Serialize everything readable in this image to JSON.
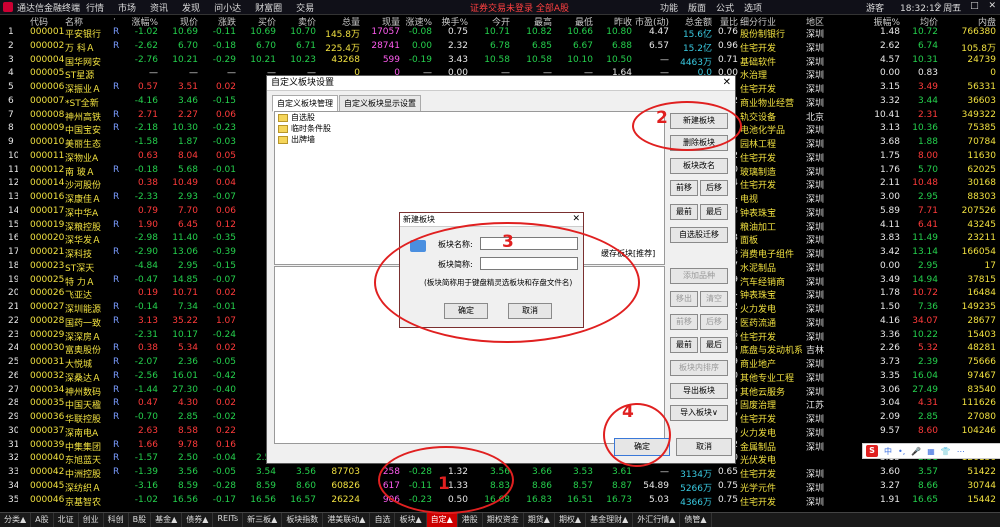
{
  "app": {
    "title": "通达信金融终端",
    "menu": [
      "行情",
      "市场",
      "资讯",
      "发现",
      "问小达",
      "财富圈",
      "交易"
    ],
    "notice": "证券交易未登录  全部A股",
    "right_menu": [
      "功能",
      "版面",
      "公式",
      "选项"
    ],
    "user": "游客",
    "clock": "18:32:12 周五",
    "window_buttons": [
      "◇",
      "—",
      "□",
      "✕"
    ]
  },
  "table": {
    "headers": [
      "代码",
      "名称",
      "·",
      "涨幅%",
      "现价",
      "涨跌",
      "买价",
      "卖价",
      "总量",
      "现量",
      "涨速%",
      "换手%",
      "今开",
      "最高",
      "最低",
      "昨收",
      "市盈(动)",
      "总金额",
      "量比",
      "细分行业",
      "地区",
      "振幅%",
      "均价",
      "内盘"
    ],
    "rows": [
      [
        "1",
        "000001",
        "平安银行",
        "R",
        "-1.02",
        "10.69",
        "-0.11",
        "10.69",
        "10.70",
        "145.8万",
        "17057",
        "-0.08",
        "0.75",
        "10.71",
        "10.82",
        "10.66",
        "10.80",
        "4.47",
        "15.6亿",
        "0.76",
        "股份制银行",
        "深圳",
        "1.48",
        "10.72",
        "766380"
      ],
      [
        "2",
        "000002",
        "万 科Ａ",
        "R",
        "-2.62",
        "6.70",
        "-0.18",
        "6.70",
        "6.71",
        "225.4万",
        "28741",
        "0.00",
        "2.32",
        "6.78",
        "6.85",
        "6.67",
        "6.88",
        "6.57",
        "15.2亿",
        "0.96",
        "住宅开发",
        "深圳",
        "2.62",
        "6.74",
        "105.8万"
      ],
      [
        "3",
        "000004",
        "国华网安",
        "",
        "-2.76",
        "10.21",
        "-0.29",
        "10.21",
        "10.23",
        "43268",
        "599",
        "-0.19",
        "3.43",
        "10.58",
        "10.58",
        "10.10",
        "10.50",
        "—",
        "4463万",
        "0.71",
        "基础软件",
        "深圳",
        "4.57",
        "10.31",
        "24739"
      ],
      [
        "4",
        "000005",
        "ST星源",
        "",
        "—",
        "—",
        "—",
        "—",
        "—",
        "0",
        "0",
        "—",
        "0.00",
        "—",
        "—",
        "—",
        "1.64",
        "—",
        "0.0",
        "0.00",
        "水治理",
        "深圳",
        "0.00",
        "0.83",
        "0"
      ],
      [
        "5",
        "000006",
        "深振业Ａ",
        "R",
        "0.57",
        "3.51",
        "0.02",
        "",
        "",
        "",
        "",
        "",
        "",
        "",
        "",
        "",
        "",
        "",
        "",
        "",
        "住宅开发",
        "深圳",
        "3.15",
        "3.49",
        "56331"
      ],
      [
        "6",
        "000007",
        "*ST全新",
        "",
        "-4.16",
        "3.46",
        "-0.15",
        "",
        "",
        "",
        "",
        "",
        "",
        "",
        "",
        "",
        "",
        "",
        "",
        "1.92",
        "商业物业经营",
        "深圳",
        "3.32",
        "3.44",
        "36603"
      ],
      [
        "7",
        "000008",
        "神州高铁",
        "R",
        "2.71",
        "2.27",
        "0.06",
        "",
        "",
        "",
        "",
        "",
        "",
        "",
        "",
        "",
        "",
        "",
        "",
        "",
        "轨交设备",
        "北京",
        "10.41",
        "2.31",
        "349322"
      ],
      [
        "8",
        "000009",
        "中国宝安",
        "R",
        "-2.18",
        "10.30",
        "-0.23",
        "",
        "",
        "",
        "",
        "",
        "",
        "",
        "",
        "",
        "",
        "",
        "",
        "",
        "电池化学品",
        "深圳",
        "3.13",
        "10.36",
        "75385"
      ],
      [
        "9",
        "000010",
        "美丽生态",
        "",
        "-1.58",
        "1.87",
        "-0.03",
        "",
        "",
        "",
        "",
        "",
        "",
        "",
        "",
        "",
        "",
        "",
        "",
        "",
        "园林工程",
        "深圳",
        "3.68",
        "1.88",
        "70784"
      ],
      [
        "10",
        "000011",
        "深物业A",
        "",
        "0.63",
        "8.04",
        "0.05",
        "",
        "",
        "",
        "",
        "",
        "",
        "",
        "",
        "",
        "",
        "",
        "",
        "0.72",
        "住宅开发",
        "深圳",
        "1.75",
        "8.00",
        "11630"
      ],
      [
        "11",
        "000012",
        "南 玻Ａ",
        "R",
        "-0.18",
        "5.68",
        "-0.01",
        "",
        "",
        "",
        "",
        "",
        "",
        "",
        "",
        "",
        "",
        "",
        "",
        "0.80",
        "玻璃制造",
        "深圳",
        "1.76",
        "5.70",
        "62025"
      ],
      [
        "12",
        "000014",
        "沙河股份",
        "",
        "0.38",
        "10.49",
        "0.04",
        "",
        "",
        "",
        "",
        "",
        "",
        "",
        "",
        "",
        "",
        "",
        "",
        "0.84",
        "住宅开发",
        "深圳",
        "2.11",
        "10.48",
        "30168"
      ],
      [
        "13",
        "000016",
        "深康佳Ａ",
        "R",
        "-2.33",
        "2.93",
        "-0.07",
        "",
        "",
        "",
        "",
        "",
        "",
        "",
        "",
        "",
        "",
        "",
        "",
        "0.81",
        "电视",
        "深圳",
        "3.00",
        "2.95",
        "88303"
      ],
      [
        "14",
        "000017",
        "深中华A",
        "",
        "0.79",
        "7.70",
        "0.06",
        "",
        "",
        "",
        "",
        "",
        "",
        "",
        "",
        "",
        "",
        "",
        "",
        "0.88",
        "钟表珠宝",
        "深圳",
        "5.89",
        "7.71",
        "207526"
      ],
      [
        "15",
        "000019",
        "深粮控股",
        "R",
        "1.90",
        "6.45",
        "0.12",
        "",
        "",
        "",
        "",
        "",
        "",
        "",
        "",
        "",
        "",
        "",
        "",
        "",
        "粮油加工",
        "深圳",
        "4.11",
        "6.41",
        "43245"
      ],
      [
        "16",
        "000020",
        "深华发Ａ",
        "",
        "-2.98",
        "11.40",
        "-0.35",
        "",
        "",
        "",
        "",
        "",
        "",
        "",
        "",
        "",
        "",
        "",
        "",
        "0.63",
        "面板",
        "深圳",
        "3.83",
        "11.49",
        "23211"
      ],
      [
        "17",
        "000021",
        "深科技",
        "R",
        "-2.90",
        "13.06",
        "-0.39",
        "",
        "",
        "",
        "",
        "",
        "",
        "",
        "",
        "",
        "",
        "",
        "",
        "0.76",
        "消费电子组件",
        "深圳",
        "3.42",
        "13.14",
        "166054"
      ],
      [
        "18",
        "000023",
        "ST深天",
        "",
        "-4.84",
        "2.95",
        "-0.15",
        "",
        "",
        "",
        "",
        "",
        "",
        "",
        "",
        "",
        "",
        "",
        "",
        "0.07",
        "水泥制品",
        "深圳",
        "0.00",
        "2.95",
        "17"
      ],
      [
        "19",
        "000025",
        "特 力Ａ",
        "R",
        "-0.47",
        "14.85",
        "-0.07",
        "",
        "",
        "",
        "",
        "",
        "",
        "",
        "",
        "",
        "",
        "",
        "",
        "0.39",
        "汽车经销商",
        "深圳",
        "3.49",
        "14.94",
        "37815"
      ],
      [
        "20",
        "000026",
        "飞亚达",
        "",
        "0.19",
        "10.71",
        "0.02",
        "",
        "",
        "",
        "",
        "",
        "",
        "",
        "",
        "",
        "",
        "",
        "",
        "0.51",
        "钟表珠宝",
        "深圳",
        "1.78",
        "10.72",
        "16484"
      ],
      [
        "21",
        "000027",
        "深圳能源",
        "R",
        "-0.14",
        "7.34",
        "-0.01",
        "",
        "",
        "",
        "",
        "",
        "",
        "",
        "",
        "",
        "",
        "",
        "",
        "0.72",
        "火力发电",
        "深圳",
        "1.50",
        "7.36",
        "149235"
      ],
      [
        "22",
        "000028",
        "国药一致",
        "R",
        "3.13",
        "35.22",
        "1.07",
        "",
        "",
        "",
        "",
        "",
        "",
        "",
        "",
        "",
        "",
        "",
        "",
        "0.92",
        "医药流通",
        "深圳",
        "4.16",
        "34.07",
        "28677"
      ],
      [
        "23",
        "000029",
        "深深房Ａ",
        "",
        "-2.31",
        "10.17",
        "-0.24",
        "",
        "",
        "",
        "",
        "",
        "",
        "",
        "",
        "",
        "",
        "",
        "",
        "0.86",
        "住宅开发",
        "深圳",
        "3.36",
        "10.22",
        "15403"
      ],
      [
        "24",
        "000030",
        "富奥股份",
        "R",
        "0.38",
        "5.34",
        "0.02",
        "",
        "",
        "",
        "",
        "",
        "",
        "",
        "",
        "",
        "",
        "",
        "",
        "0.75",
        "底盘与发动机系",
        "吉林",
        "2.26",
        "5.32",
        "48281"
      ],
      [
        "25",
        "000031",
        "大悦城",
        "R",
        "-2.07",
        "2.36",
        "-0.05",
        "",
        "",
        "",
        "",
        "",
        "",
        "",
        "",
        "",
        "",
        "",
        "",
        "0.89",
        "商业地产",
        "深圳",
        "3.73",
        "2.39",
        "75666"
      ],
      [
        "26",
        "000032",
        "深桑达Ａ",
        "R",
        "-2.56",
        "16.01",
        "-0.42",
        "",
        "",
        "",
        "",
        "",
        "",
        "",
        "",
        "",
        "",
        "",
        "",
        "1.00",
        "其他专业工程",
        "深圳",
        "3.35",
        "16.04",
        "97467"
      ],
      [
        "27",
        "000034",
        "神州数码",
        "R",
        "-1.44",
        "27.30",
        "-0.40",
        "",
        "",
        "",
        "",
        "",
        "",
        "",
        "",
        "",
        "",
        "",
        "",
        "0.65",
        "其他云服务",
        "深圳",
        "3.06",
        "27.49",
        "83540"
      ],
      [
        "28",
        "000035",
        "中国天楹",
        "R",
        "0.47",
        "4.30",
        "0.02",
        "",
        "",
        "",
        "",
        "",
        "",
        "",
        "",
        "",
        "",
        "",
        "",
        "0.73",
        "固废治理",
        "江苏",
        "3.04",
        "4.31",
        "111626"
      ],
      [
        "29",
        "000036",
        "华联控股",
        "R",
        "-0.70",
        "2.85",
        "-0.02",
        "",
        "",
        "",
        "",
        "",
        "",
        "",
        "",
        "",
        "",
        "",
        "",
        "0.97",
        "住宅开发",
        "深圳",
        "2.09",
        "2.85",
        "27080"
      ],
      [
        "30",
        "000037",
        "深南电A",
        "",
        "2.63",
        "8.58",
        "0.22",
        "",
        "",
        "",
        "",
        "",
        "",
        "",
        "",
        "",
        "",
        "",
        "",
        "0.70",
        "火力发电",
        "深圳",
        "9.57",
        "8.60",
        "104246"
      ],
      [
        "31",
        "000039",
        "中集集团",
        "R",
        "1.66",
        "9.78",
        "0.16",
        "",
        "",
        "",
        "",
        "",
        "",
        "",
        "",
        "",
        "",
        "",
        "",
        "1.12",
        "金属制品",
        "深圳",
        "",
        "",
        "—"
      ],
      [
        "32",
        "000040",
        "东旭蓝天",
        "R",
        "-1.57",
        "2.50",
        "-0.04",
        "2.50",
        "",
        "",
        "",
        "",
        "",
        "",
        "",
        "",
        "",
        "",
        "",
        "1.90",
        "光伏发电",
        "",
        "3.15",
        "2.51",
        "126136"
      ],
      [
        "33",
        "000042",
        "中洲控股",
        "R",
        "-1.39",
        "3.56",
        "-0.05",
        "3.54",
        "3.56",
        "87703",
        "258",
        "-0.28",
        "1.32",
        "3.56",
        "3.66",
        "3.53",
        "3.61",
        "—",
        "3134万",
        "0.65",
        "住宅开发",
        "深圳",
        "3.60",
        "3.57",
        "51422"
      ],
      [
        "34",
        "000045",
        "深纺织Ａ",
        "",
        "-3.16",
        "8.59",
        "-0.28",
        "8.59",
        "8.60",
        "60826",
        "617",
        "-0.11",
        "1.33",
        "8.83",
        "8.86",
        "8.57",
        "8.87",
        "54.89",
        "5266万",
        "0.75",
        "光学元件",
        "深圳",
        "3.27",
        "8.66",
        "30744"
      ],
      [
        "35",
        "000046",
        "京基智农",
        "",
        "-1.02",
        "16.56",
        "-0.17",
        "16.56",
        "16.57",
        "26224",
        "906",
        "-0.23",
        "0.50",
        "16.68",
        "16.83",
        "16.51",
        "16.73",
        "5.03",
        "4366万",
        "0.75",
        "住宅开发",
        "深圳",
        "1.91",
        "16.65",
        "15442"
      ]
    ]
  },
  "bottom_tabs": [
    "分类▲",
    "A股",
    "北证",
    "创业",
    "科创",
    "B股",
    "基金▲",
    "债券▲",
    "REITs",
    "新三板▲",
    "板块指数",
    "港美联动▲",
    "自选",
    "板块▲",
    "自定▲",
    "港股",
    "期权资金",
    "期货▲",
    "期权▲",
    "基金理财▲",
    "外汇行情▲",
    "债管▲"
  ],
  "dialog_custom": {
    "title": "自定义板块设置",
    "close": "✕",
    "tabs": [
      "自定义板块管理",
      "自定义板块显示设置"
    ],
    "folders": [
      "自选股",
      "临时条件股",
      "出牌墙"
    ],
    "buttons": {
      "new_block": "新建板块",
      "delete_block": "删除板块",
      "rename_block": "板块改名",
      "move_front": "前移",
      "move_back": "后移",
      "move_top": "最前",
      "move_bottom": "最后",
      "migrate_watchlist": "自选股迁移",
      "add_stock": "添加品种",
      "remove": "移出",
      "clear": "清空",
      "move_front2": "前移",
      "move_back2": "后移",
      "move_top2": "最前",
      "move_bottom2": "最后",
      "sort_in_block": "板块内排序",
      "export_block": "导出板块",
      "import_block": "导入板块∨",
      "ok": "确定",
      "cancel": "取消"
    },
    "hint": "缓存板块[推荐]"
  },
  "dialog_new": {
    "title": "新建板块",
    "close": "✕",
    "name_label": "板块名称:",
    "abbr_label": "板块简称:",
    "name_value": "",
    "abbr_value": "",
    "note": "(板块简称用于键盘精灵选板块和存盘文件名)",
    "ok": "确定",
    "cancel": "取消"
  },
  "annotations": [
    "1",
    "2",
    "3",
    "4"
  ],
  "ime": {
    "logo": "S",
    "items": [
      "中",
      "•,",
      "🎤",
      "▦",
      "👕",
      "⋯"
    ]
  },
  "colors": {
    "up": "#ff3b3b",
    "down": "#25d04d",
    "highlight": "#f0e040",
    "annot": "#e02020"
  }
}
